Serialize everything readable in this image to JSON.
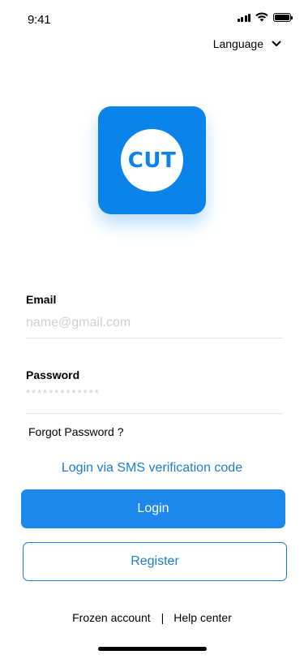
{
  "status_bar": {
    "time": "9:41"
  },
  "header": {
    "language_label": "Language",
    "language_icon": "chevron-down-icon"
  },
  "logo": {
    "text": "CUT",
    "brand_color": "#0a84ea"
  },
  "form": {
    "email": {
      "label": "Email",
      "placeholder": "name@gmail.com"
    },
    "password": {
      "label": "Password",
      "placeholder": "*************"
    },
    "forgot_password": "Forgot Password ?",
    "sms_login": "Login via SMS verification code"
  },
  "actions": {
    "login_label": "Login",
    "register_label": "Register",
    "accent_color": "#1c88ec"
  },
  "footer": {
    "frozen_account": "Frozen account",
    "separator": "|",
    "help_center": "Help center"
  }
}
